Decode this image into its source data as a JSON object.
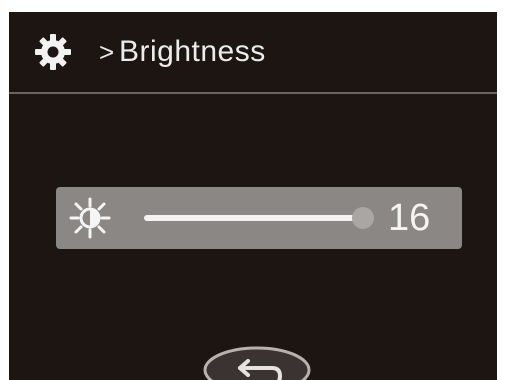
{
  "header": {
    "separator": ">",
    "title": "Brightness",
    "icon": "gear-icon"
  },
  "brightness": {
    "icon": "sun-icon",
    "value": "16",
    "level_fraction": 1.0
  },
  "footer": {
    "back_icon": "back-arrow-icon"
  },
  "colors": {
    "background": "#1c1512",
    "panel": "#8b8785",
    "text": "#ececec"
  }
}
